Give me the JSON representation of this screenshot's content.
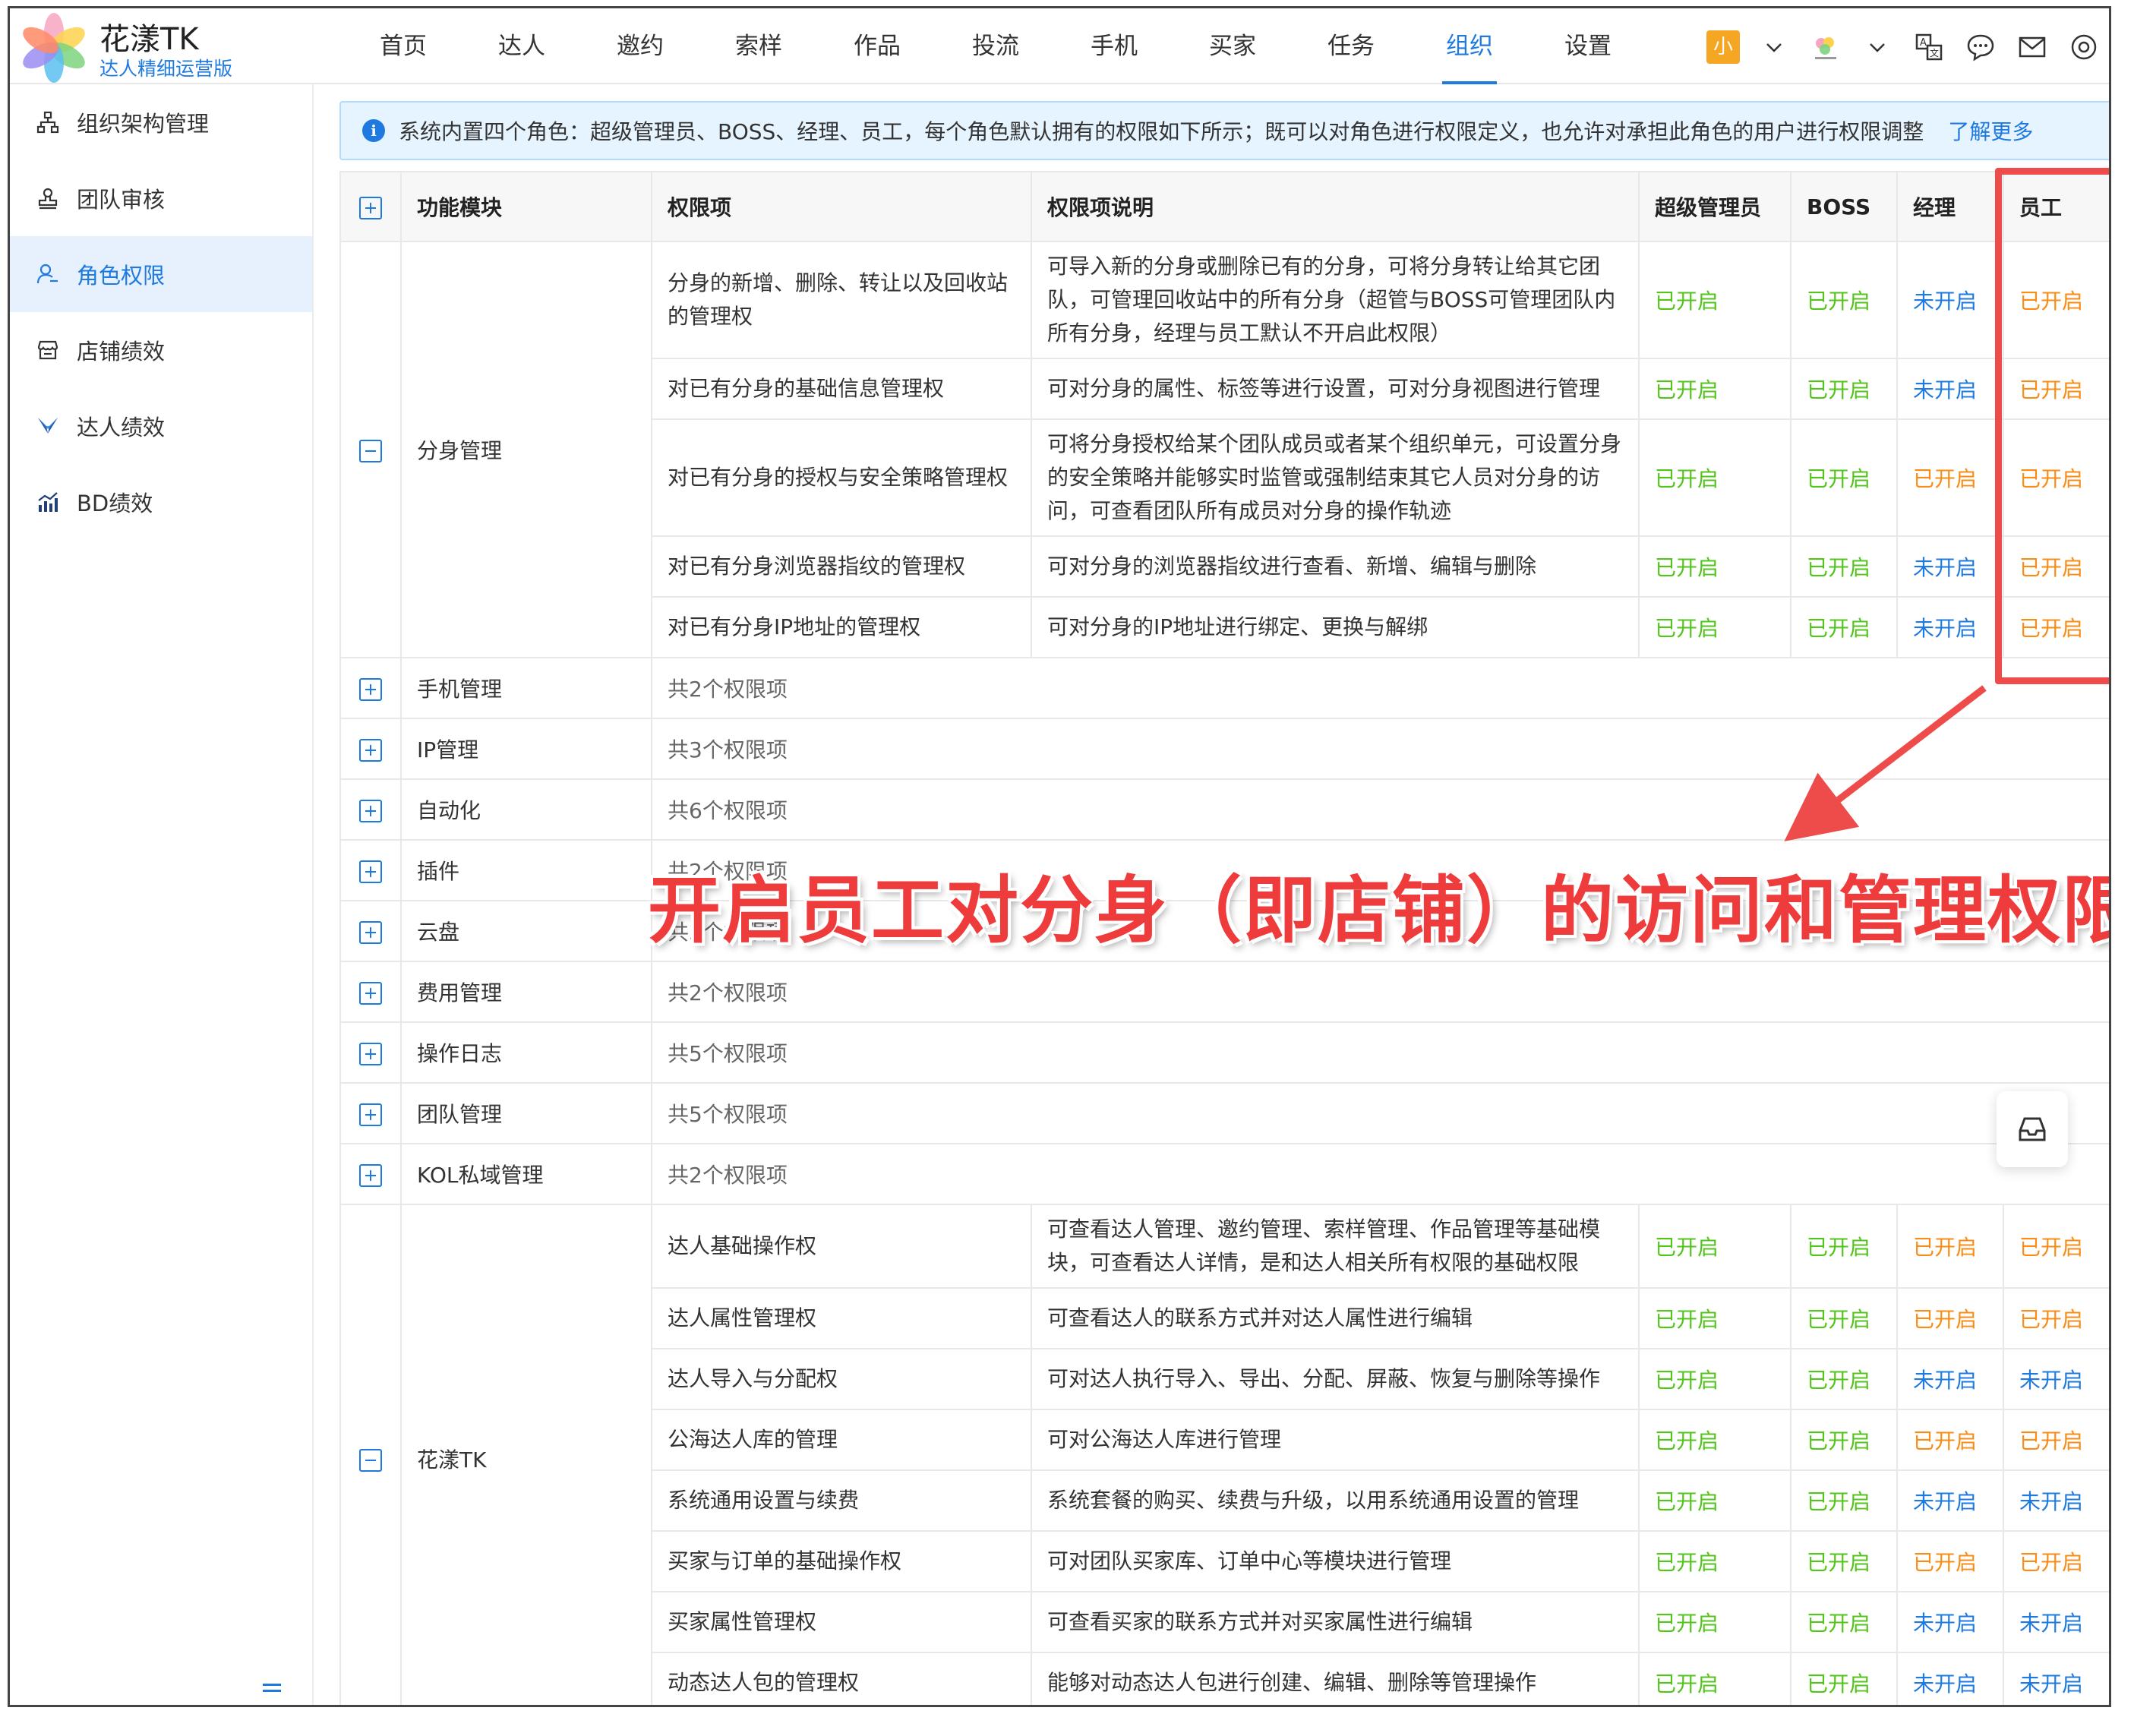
{
  "brand": {
    "title": "花漾TK",
    "subtitle": "达人精细运营版"
  },
  "nav": [
    "首页",
    "达人",
    "邀约",
    "索样",
    "作品",
    "投流",
    "手机",
    "买家",
    "任务",
    "组织",
    "设置"
  ],
  "nav_active": "组织",
  "top": {
    "avatar_text": "小"
  },
  "sidebar": [
    {
      "label": "组织架构管理",
      "icon": "org-tree-icon"
    },
    {
      "label": "团队审核",
      "icon": "stamp-icon"
    },
    {
      "label": "角色权限",
      "icon": "user-role-icon",
      "active": true
    },
    {
      "label": "店铺绩效",
      "icon": "shop-icon"
    },
    {
      "label": "达人绩效",
      "icon": "paper-plane-icon"
    },
    {
      "label": "BD绩效",
      "icon": "chart-icon"
    }
  ],
  "info": {
    "text": "系统内置四个角色：超级管理员、BOSS、经理、员工，每个角色默认拥有的权限如下所示；既可以对角色进行权限定义，也允许对承担此角色的用户进行权限调整",
    "link": "了解更多"
  },
  "table": {
    "headers": {
      "module": "功能模块",
      "perm": "权限项",
      "desc": "权限项说明",
      "r1": "超级管理员",
      "r2": "BOSS",
      "r3": "经理",
      "r4": "员工"
    },
    "group1": {
      "module": "分身管理",
      "rows": [
        {
          "perm": "分身的新增、删除、转让以及回收站的管理权",
          "desc": "可导入新的分身或删除已有的分身，可将分身转让给其它团队，可管理回收站中的所有分身（超管与BOSS可管理团队内所有分身，经理与员工默认不开启此权限）",
          "r1": "已开启",
          "r2": "已开启",
          "r3": "未开启",
          "r4": "已开启"
        },
        {
          "perm": "对已有分身的基础信息管理权",
          "desc": "可对分身的属性、标签等进行设置，可对分身视图进行管理",
          "r1": "已开启",
          "r2": "已开启",
          "r3": "未开启",
          "r4": "已开启"
        },
        {
          "perm": "对已有分身的授权与安全策略管理权",
          "desc": "可将分身授权给某个团队成员或者某个组织单元，可设置分身的安全策略并能够实时监管或强制结束其它人员对分身的访问，可查看团队所有成员对分身的操作轨迹",
          "r1": "已开启",
          "r2": "已开启",
          "r3": "已开启",
          "r4": "已开启"
        },
        {
          "perm": "对已有分身浏览器指纹的管理权",
          "desc": "可对分身的浏览器指纹进行查看、新增、编辑与删除",
          "r1": "已开启",
          "r2": "已开启",
          "r3": "未开启",
          "r4": "已开启"
        },
        {
          "perm": "对已有分身IP地址的管理权",
          "desc": "可对分身的IP地址进行绑定、更换与解绑",
          "r1": "已开启",
          "r2": "已开启",
          "r3": "未开启",
          "r4": "已开启"
        }
      ]
    },
    "collapsed": [
      {
        "module": "手机管理",
        "summary": "共2个权限项"
      },
      {
        "module": "IP管理",
        "summary": "共3个权限项"
      },
      {
        "module": "自动化",
        "summary": "共6个权限项"
      },
      {
        "module": "插件",
        "summary": "共2个权限项"
      },
      {
        "module": "云盘",
        "summary": "共3个权限项"
      },
      {
        "module": "费用管理",
        "summary": "共2个权限项"
      },
      {
        "module": "操作日志",
        "summary": "共5个权限项"
      },
      {
        "module": "团队管理",
        "summary": "共5个权限项"
      },
      {
        "module": "KOL私域管理",
        "summary": "共2个权限项"
      }
    ],
    "group2": {
      "module": "花漾TK",
      "rows": [
        {
          "perm": "达人基础操作权",
          "desc": "可查看达人管理、邀约管理、索样管理、作品管理等基础模块，可查看达人详情，是和达人相关所有权限的基础权限",
          "r1": "已开启",
          "r2": "已开启",
          "r3": "已开启",
          "r4": "已开启"
        },
        {
          "perm": "达人属性管理权",
          "desc": "可查看达人的联系方式并对达人属性进行编辑",
          "r1": "已开启",
          "r2": "已开启",
          "r3": "已开启",
          "r4": "已开启"
        },
        {
          "perm": "达人导入与分配权",
          "desc": "可对达人执行导入、导出、分配、屏蔽、恢复与删除等操作",
          "r1": "已开启",
          "r2": "已开启",
          "r3": "未开启",
          "r4": "未开启"
        },
        {
          "perm": "公海达人库的管理",
          "desc": "可对公海达人库进行管理",
          "r1": "已开启",
          "r2": "已开启",
          "r3": "已开启",
          "r4": "已开启"
        },
        {
          "perm": "系统通用设置与续费",
          "desc": "系统套餐的购买、续费与升级，以用系统通用设置的管理",
          "r1": "已开启",
          "r2": "已开启",
          "r3": "未开启",
          "r4": "未开启"
        },
        {
          "perm": "买家与订单的基础操作权",
          "desc": "可对团队买家库、订单中心等模块进行管理",
          "r1": "已开启",
          "r2": "已开启",
          "r3": "已开启",
          "r4": "已开启"
        },
        {
          "perm": "买家属性管理权",
          "desc": "可查看买家的联系方式并对买家属性进行编辑",
          "r1": "已开启",
          "r2": "已开启",
          "r3": "未开启",
          "r4": "未开启"
        },
        {
          "perm": "动态达人包的管理权",
          "desc": "能够对动态达人包进行创建、编辑、删除等管理操作",
          "r1": "已开启",
          "r2": "已开启",
          "r3": "未开启",
          "r4": "未开启"
        }
      ]
    }
  },
  "annotation": {
    "callout": "开启员工对分身（即店铺）的访问和管理权限",
    "color": "#ee3b3b"
  },
  "colors": {
    "accent": "#1f7ae0",
    "enabled_green": "#52c41a",
    "enabled_orange": "#fa8c16",
    "disabled_blue": "#1f7ae0"
  }
}
